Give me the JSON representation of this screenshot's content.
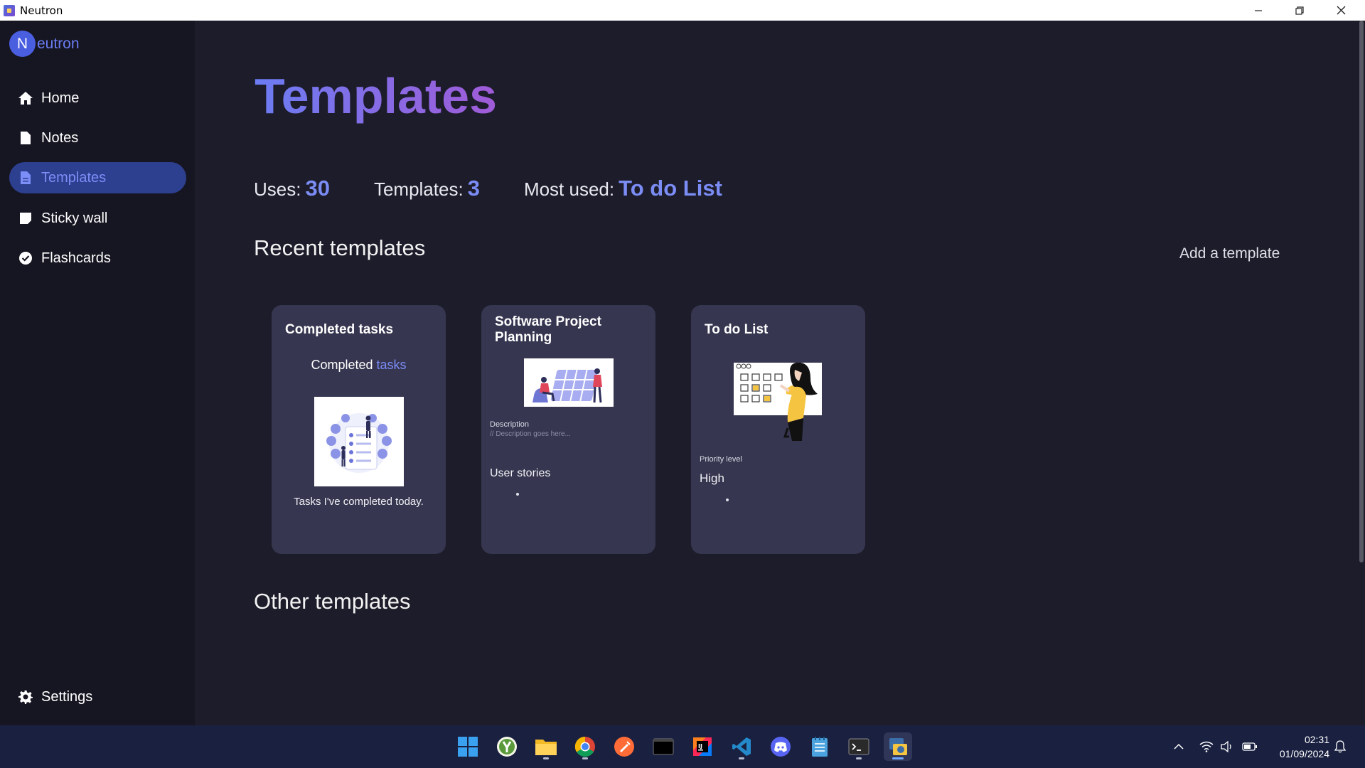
{
  "window": {
    "title": "Neutron",
    "controls": [
      "minimize",
      "restore",
      "close"
    ]
  },
  "brand": {
    "letter": "N",
    "text": "eutron"
  },
  "sidebar": {
    "items": [
      {
        "label": "Home",
        "icon": "home-icon",
        "active": false
      },
      {
        "label": "Notes",
        "icon": "note-icon",
        "active": false
      },
      {
        "label": "Templates",
        "icon": "template-icon",
        "active": true
      },
      {
        "label": "Sticky wall",
        "icon": "sticky-note-icon",
        "active": false
      },
      {
        "label": "Flashcards",
        "icon": "check-circle-icon",
        "active": false
      }
    ],
    "settings_label": "Settings"
  },
  "main": {
    "title": "Templates",
    "stats": {
      "uses_label": "Uses:",
      "uses_value": "30",
      "templates_label": "Templates:",
      "templates_value": "3",
      "most_used_label": "Most used:",
      "most_used_value": "To do List"
    },
    "recent_title": "Recent templates",
    "add_template_label": "Add a template",
    "other_title": "Other templates",
    "cards": [
      {
        "title": "Completed tasks",
        "heading_prefix": "Completed ",
        "heading_link": "tasks",
        "caption": "Tasks I've completed today."
      },
      {
        "title": "Software Project Planning",
        "description_label": "Description",
        "description_placeholder": "// Description goes here...",
        "section_label": "User stories"
      },
      {
        "title": "To do List",
        "priority_label": "Priority level",
        "priority_value": "High"
      }
    ]
  },
  "taskbar": {
    "apps": [
      "windows-start-icon",
      "app-y-icon",
      "file-explorer-icon",
      "chrome-icon",
      "postman-icon",
      "terminal-icon",
      "intellij-icon",
      "vscode-icon",
      "discord-icon",
      "notepad-icon",
      "cmd-icon",
      "python-icon"
    ],
    "clock_time": "02:31",
    "clock_date": "01/09/2024"
  },
  "colors": {
    "accent": "#7b8cf5",
    "sidebar_bg": "#161622",
    "main_bg": "#1c1c2a",
    "card_bg": "#363650",
    "active_nav": "#2d3f8f"
  }
}
